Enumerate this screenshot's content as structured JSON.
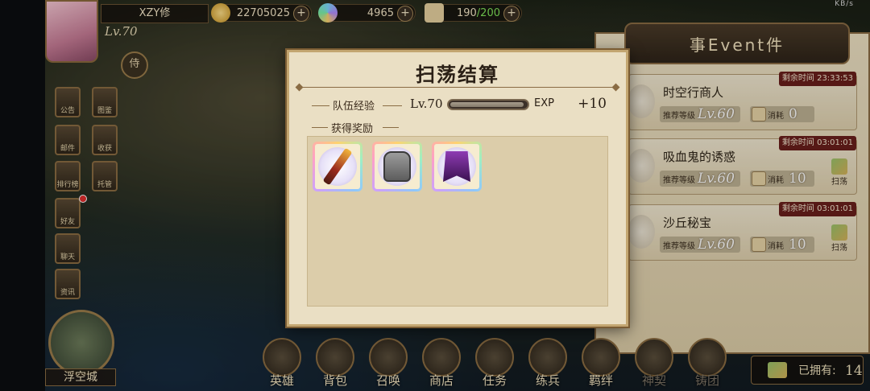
{
  "player": {
    "name": "XZY修",
    "level": "Lv.70",
    "guild_badge": "侍"
  },
  "resources": {
    "gold": {
      "value": "22705025",
      "add": "+"
    },
    "gems": {
      "value": "4965",
      "add": "+"
    },
    "stamina": {
      "current": "190",
      "max": "/200",
      "add": "+"
    }
  },
  "left_menu": [
    {
      "id": "announcement",
      "label": "公告"
    },
    {
      "id": "book",
      "label": "图鉴"
    },
    {
      "id": "mail",
      "label": "邮件"
    },
    {
      "id": "harvest",
      "label": "收获"
    },
    {
      "id": "ranking",
      "label": "排行榜"
    },
    {
      "id": "tower",
      "label": "托管"
    },
    {
      "id": "friends",
      "label": "好友"
    },
    {
      "id": "chat",
      "label": "聊天"
    },
    {
      "id": "info",
      "label": "资讯"
    }
  ],
  "floating_city": {
    "label": "浮空城"
  },
  "event_panel": {
    "title": "事Event件",
    "events": [
      {
        "name": "时空行商人",
        "timer": "剩余时间 23:33:53",
        "rec_label": "推荐等级",
        "rec_level": "Lv.60",
        "cost_label": "消耗",
        "cost": "0",
        "sweep": ""
      },
      {
        "name": "吸血鬼的诱惑",
        "timer": "剩余时间 03:01:01",
        "rec_label": "推荐等级",
        "rec_level": "Lv.60",
        "cost_label": "消耗",
        "cost": "10",
        "sweep": "扫荡"
      },
      {
        "name": "沙丘秘宝",
        "timer": "剩余时间 03:01:01",
        "rec_label": "推荐等级",
        "rec_level": "Lv.60",
        "cost_label": "消耗",
        "cost": "10",
        "sweep": "扫荡"
      }
    ]
  },
  "bottom_nav": [
    "英雄",
    "背包",
    "召唤",
    "商店",
    "任务",
    "练兵",
    "羁绊",
    "神契",
    "铸团"
  ],
  "owned": {
    "label": "已拥有:",
    "count": "14"
  },
  "modal": {
    "title": "扫荡结算",
    "team_exp_label": "队伍经验",
    "level": "Lv.70",
    "exp_progress": 0.97,
    "exp_unit": "EXP",
    "exp_gain": "+10",
    "rewards_label": "获得奖励",
    "rewards": [
      {
        "icon": "spear-weapon-icon"
      },
      {
        "icon": "steel-armor-icon"
      },
      {
        "icon": "purple-robe-icon"
      }
    ]
  },
  "status_bar": {
    "indicators": "KB/s"
  }
}
